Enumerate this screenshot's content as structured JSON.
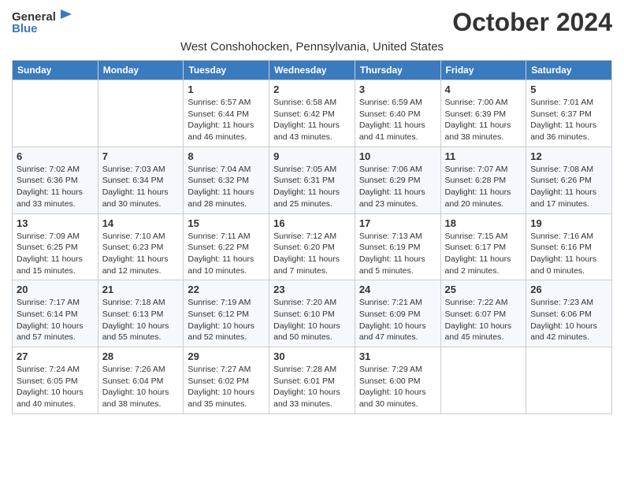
{
  "header": {
    "logo_general": "General",
    "logo_blue": "Blue",
    "month": "October 2024",
    "location": "West Conshohocken, Pennsylvania, United States"
  },
  "weekdays": [
    "Sunday",
    "Monday",
    "Tuesday",
    "Wednesday",
    "Thursday",
    "Friday",
    "Saturday"
  ],
  "weeks": [
    [
      {
        "day": "",
        "info": ""
      },
      {
        "day": "",
        "info": ""
      },
      {
        "day": "1",
        "info": "Sunrise: 6:57 AM\nSunset: 6:44 PM\nDaylight: 11 hours and 46 minutes."
      },
      {
        "day": "2",
        "info": "Sunrise: 6:58 AM\nSunset: 6:42 PM\nDaylight: 11 hours and 43 minutes."
      },
      {
        "day": "3",
        "info": "Sunrise: 6:59 AM\nSunset: 6:40 PM\nDaylight: 11 hours and 41 minutes."
      },
      {
        "day": "4",
        "info": "Sunrise: 7:00 AM\nSunset: 6:39 PM\nDaylight: 11 hours and 38 minutes."
      },
      {
        "day": "5",
        "info": "Sunrise: 7:01 AM\nSunset: 6:37 PM\nDaylight: 11 hours and 36 minutes."
      }
    ],
    [
      {
        "day": "6",
        "info": "Sunrise: 7:02 AM\nSunset: 6:36 PM\nDaylight: 11 hours and 33 minutes."
      },
      {
        "day": "7",
        "info": "Sunrise: 7:03 AM\nSunset: 6:34 PM\nDaylight: 11 hours and 30 minutes."
      },
      {
        "day": "8",
        "info": "Sunrise: 7:04 AM\nSunset: 6:32 PM\nDaylight: 11 hours and 28 minutes."
      },
      {
        "day": "9",
        "info": "Sunrise: 7:05 AM\nSunset: 6:31 PM\nDaylight: 11 hours and 25 minutes."
      },
      {
        "day": "10",
        "info": "Sunrise: 7:06 AM\nSunset: 6:29 PM\nDaylight: 11 hours and 23 minutes."
      },
      {
        "day": "11",
        "info": "Sunrise: 7:07 AM\nSunset: 6:28 PM\nDaylight: 11 hours and 20 minutes."
      },
      {
        "day": "12",
        "info": "Sunrise: 7:08 AM\nSunset: 6:26 PM\nDaylight: 11 hours and 17 minutes."
      }
    ],
    [
      {
        "day": "13",
        "info": "Sunrise: 7:09 AM\nSunset: 6:25 PM\nDaylight: 11 hours and 15 minutes."
      },
      {
        "day": "14",
        "info": "Sunrise: 7:10 AM\nSunset: 6:23 PM\nDaylight: 11 hours and 12 minutes."
      },
      {
        "day": "15",
        "info": "Sunrise: 7:11 AM\nSunset: 6:22 PM\nDaylight: 11 hours and 10 minutes."
      },
      {
        "day": "16",
        "info": "Sunrise: 7:12 AM\nSunset: 6:20 PM\nDaylight: 11 hours and 7 minutes."
      },
      {
        "day": "17",
        "info": "Sunrise: 7:13 AM\nSunset: 6:19 PM\nDaylight: 11 hours and 5 minutes."
      },
      {
        "day": "18",
        "info": "Sunrise: 7:15 AM\nSunset: 6:17 PM\nDaylight: 11 hours and 2 minutes."
      },
      {
        "day": "19",
        "info": "Sunrise: 7:16 AM\nSunset: 6:16 PM\nDaylight: 11 hours and 0 minutes."
      }
    ],
    [
      {
        "day": "20",
        "info": "Sunrise: 7:17 AM\nSunset: 6:14 PM\nDaylight: 10 hours and 57 minutes."
      },
      {
        "day": "21",
        "info": "Sunrise: 7:18 AM\nSunset: 6:13 PM\nDaylight: 10 hours and 55 minutes."
      },
      {
        "day": "22",
        "info": "Sunrise: 7:19 AM\nSunset: 6:12 PM\nDaylight: 10 hours and 52 minutes."
      },
      {
        "day": "23",
        "info": "Sunrise: 7:20 AM\nSunset: 6:10 PM\nDaylight: 10 hours and 50 minutes."
      },
      {
        "day": "24",
        "info": "Sunrise: 7:21 AM\nSunset: 6:09 PM\nDaylight: 10 hours and 47 minutes."
      },
      {
        "day": "25",
        "info": "Sunrise: 7:22 AM\nSunset: 6:07 PM\nDaylight: 10 hours and 45 minutes."
      },
      {
        "day": "26",
        "info": "Sunrise: 7:23 AM\nSunset: 6:06 PM\nDaylight: 10 hours and 42 minutes."
      }
    ],
    [
      {
        "day": "27",
        "info": "Sunrise: 7:24 AM\nSunset: 6:05 PM\nDaylight: 10 hours and 40 minutes."
      },
      {
        "day": "28",
        "info": "Sunrise: 7:26 AM\nSunset: 6:04 PM\nDaylight: 10 hours and 38 minutes."
      },
      {
        "day": "29",
        "info": "Sunrise: 7:27 AM\nSunset: 6:02 PM\nDaylight: 10 hours and 35 minutes."
      },
      {
        "day": "30",
        "info": "Sunrise: 7:28 AM\nSunset: 6:01 PM\nDaylight: 10 hours and 33 minutes."
      },
      {
        "day": "31",
        "info": "Sunrise: 7:29 AM\nSunset: 6:00 PM\nDaylight: 10 hours and 30 minutes."
      },
      {
        "day": "",
        "info": ""
      },
      {
        "day": "",
        "info": ""
      }
    ]
  ]
}
